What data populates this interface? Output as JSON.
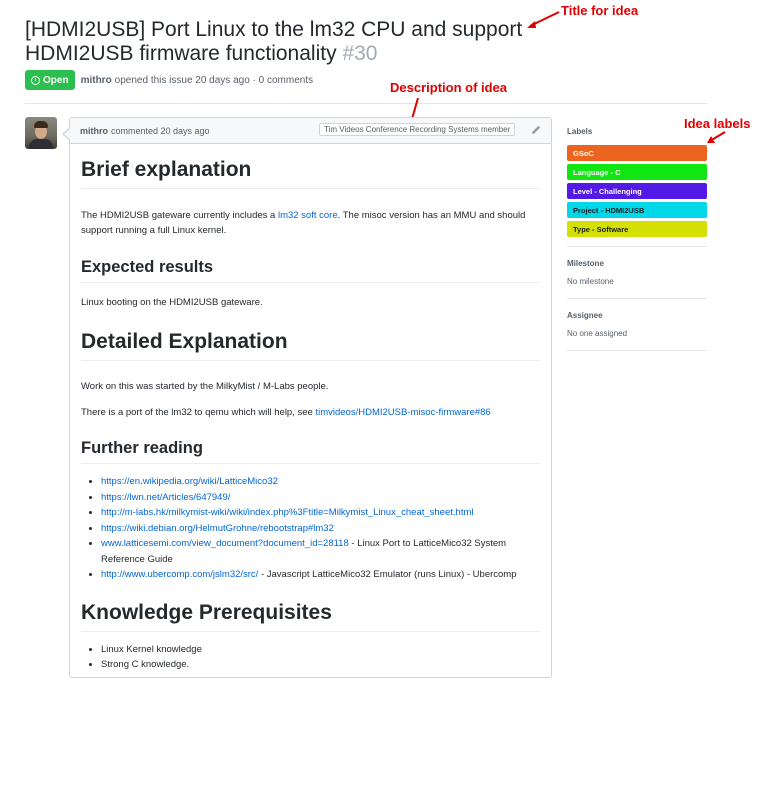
{
  "issue": {
    "title": "[HDMI2USB] Port Linux to the lm32 CPU and support HDMI2USB firmware functionality",
    "number": "#30",
    "state": "Open",
    "author": "mithro",
    "opened_text": "opened this issue 20 days ago · 0 comments"
  },
  "annotations": {
    "title": "Title for idea",
    "description": "Description of idea",
    "labels": "Idea labels"
  },
  "comment": {
    "author": "mithro",
    "time_text": "commented 20 days ago",
    "member_badge": "Tim Videos Conference Recording Systems member",
    "h_brief": "Brief explanation",
    "p_brief_1": "The HDMI2USB gateware currently includes a",
    "p_brief_link": "lm32 soft core",
    "p_brief_2": ". The misoc version has an MMU and should support running a full Linux kernel.",
    "h_expected": "Expected results",
    "p_expected": "Linux booting on the HDMI2USB gateware.",
    "h_detailed": "Detailed Explanation",
    "p_detailed_1": "Work on this was started by the MilkyMist / M-Labs people.",
    "p_detailed_2": "There is a port of the lm32 to qemu which will help, see",
    "p_detailed_link": "timvideos/HDMI2USB-misoc-firmware#86",
    "h_further": "Further reading",
    "reading": [
      {
        "link": "https://en.wikipedia.org/wiki/LatticeMico32",
        "rest": ""
      },
      {
        "link": "https://lwn.net/Articles/647949/",
        "rest": ""
      },
      {
        "link": "http://m-labs.hk/milkymist-wiki/wiki/index.php%3Ftitle=Milkymist_Linux_cheat_sheet.html",
        "rest": ""
      },
      {
        "link": "https://wiki.debian.org/HelmutGrohne/rebootstrap#lm32",
        "rest": ""
      },
      {
        "link": "www.latticesemi.com/view_document?document_id=28118",
        "rest": " - Linux Port to LatticeMico32 System Reference Guide"
      },
      {
        "link": "http://www.ubercomp.com/jslm32/src/",
        "rest": " - Javascript LatticeMico32 Emulator (runs Linux) - Ubercomp"
      }
    ],
    "h_prereq": "Knowledge Prerequisites",
    "prereq": [
      "Linux Kernel knowledge",
      "Strong C knowledge."
    ]
  },
  "sidebar": {
    "labels_heading": "Labels",
    "labels": [
      {
        "name": "GSoC",
        "color": "#eb6420",
        "text_color": "#ffffff"
      },
      {
        "name": "Language - C",
        "color": "#12e612",
        "text_color": "#ffffff"
      },
      {
        "name": "Level - Challenging",
        "color": "#5319e7",
        "text_color": "#ffffff"
      },
      {
        "name": "Project - HDMI2USB",
        "color": "#00d8e8",
        "text_color": "#1b1f23"
      },
      {
        "name": "Type - Software",
        "color": "#d4e003",
        "text_color": "#1b1f23"
      }
    ],
    "milestone_heading": "Milestone",
    "milestone_value": "No milestone",
    "assignee_heading": "Assignee",
    "assignee_value": "No one assigned"
  },
  "colors": {
    "open_green": "#2cbe4e",
    "link_blue": "#0366d6",
    "annotation_red": "#e00000"
  }
}
